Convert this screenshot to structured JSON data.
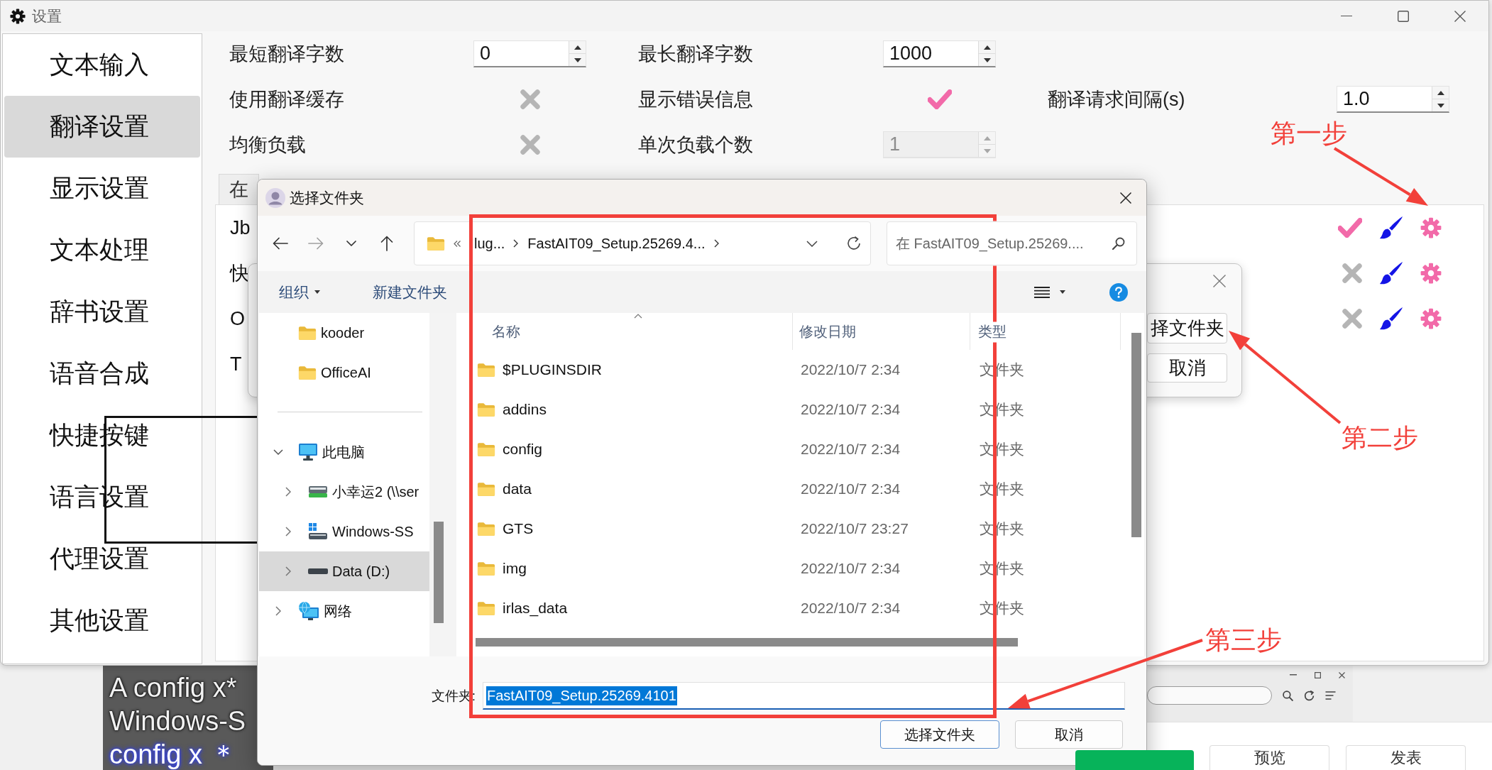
{
  "settings_window": {
    "title": "设置"
  },
  "sidebar": {
    "items": [
      {
        "label": "文本输入",
        "selected": false
      },
      {
        "label": "翻译设置",
        "selected": true
      },
      {
        "label": "显示设置",
        "selected": false
      },
      {
        "label": "文本处理",
        "selected": false
      },
      {
        "label": "辞书设置",
        "selected": false
      },
      {
        "label": "语音合成",
        "selected": false
      },
      {
        "label": "快捷按键",
        "selected": false
      },
      {
        "label": "语言设置",
        "selected": false
      },
      {
        "label": "代理设置",
        "selected": false
      },
      {
        "label": "其他设置",
        "selected": false
      }
    ]
  },
  "option_rows": [
    [
      {
        "label": "最短翻译字数",
        "kind": "spinbox",
        "value": "0",
        "disabled": false
      },
      {
        "label": "最长翻译字数",
        "kind": "spinbox",
        "value": "1000",
        "disabled": false
      }
    ],
    [
      {
        "label": "使用翻译缓存",
        "kind": "switch",
        "on": false
      },
      {
        "label": "显示错误信息",
        "kind": "switch",
        "on": true
      },
      {
        "label": "翻译请求间隔(s)",
        "kind": "spinbox",
        "value": "1.0",
        "disabled": false
      }
    ],
    [
      {
        "label": "均衡负载",
        "kind": "switch",
        "on": false
      },
      {
        "label": "单次负载个数",
        "kind": "spinbox",
        "value": "1",
        "disabled": true
      }
    ]
  ],
  "tabs": [
    {
      "label": "在",
      "selected": true
    }
  ],
  "engines": [
    {
      "name": "Jb",
      "kind": "engine",
      "on": true
    },
    {
      "name": "快",
      "kind": "engine",
      "on": false
    },
    {
      "name": "O",
      "kind": "engine",
      "on": false
    },
    {
      "name": "T",
      "kind": "plain"
    }
  ],
  "prompt_dialog": {
    "buttons": [
      {
        "label": "择文件夹"
      },
      {
        "label": "取消"
      }
    ]
  },
  "file_dialog": {
    "title": "选择文件夹",
    "nav_buttons": [
      {
        "kind": "back",
        "disabled": false
      },
      {
        "kind": "forward",
        "disabled": true
      },
      {
        "kind": "recent",
        "disabled": false
      },
      {
        "kind": "up",
        "disabled": false
      }
    ],
    "path": [
      "lug...",
      "FastAIT09_Setup.25269.4..."
    ],
    "search": {
      "placeholder": "在 FastAIT09_Setup.25269...."
    },
    "toolbar": [
      {
        "label": "组织",
        "kind": "menu"
      },
      {
        "label": "新建文件夹",
        "kind": "command"
      }
    ],
    "quick_access": [
      {
        "label": "kooder",
        "kind": "folder",
        "selected": false
      },
      {
        "label": "OfficeAI",
        "kind": "folder",
        "selected": false
      }
    ],
    "tree": [
      {
        "label": "此电脑",
        "kind": "computer",
        "expanded": true,
        "selected": false,
        "children": [
          {
            "label": "小幸运2 (\\\\ser",
            "kind": "network-drive",
            "expanded": false,
            "selected": false
          },
          {
            "label": "Windows-SS",
            "kind": "system-drive",
            "expanded": false,
            "selected": false
          },
          {
            "label": "Data (D:)",
            "kind": "drive",
            "expanded": false,
            "selected": true
          }
        ]
      },
      {
        "label": "网络",
        "kind": "network",
        "expanded": false,
        "selected": false
      }
    ],
    "columns": [
      {
        "label": "名称",
        "sorted": true
      },
      {
        "label": "修改日期",
        "sorted": false
      },
      {
        "label": "类型",
        "sorted": false
      }
    ],
    "rows": [
      {
        "name": "$PLUGINSDIR",
        "modified": "2022/10/7 2:34",
        "type": "文件夹"
      },
      {
        "name": "addins",
        "modified": "2022/10/7 2:34",
        "type": "文件夹"
      },
      {
        "name": "config",
        "modified": "2022/10/7 2:34",
        "type": "文件夹"
      },
      {
        "name": "data",
        "modified": "2022/10/7 2:34",
        "type": "文件夹"
      },
      {
        "name": "GTS",
        "modified": "2022/10/7 23:27",
        "type": "文件夹"
      },
      {
        "name": "img",
        "modified": "2022/10/7 2:34",
        "type": "文件夹"
      },
      {
        "name": "irlas_data",
        "modified": "2022/10/7 2:34",
        "type": "文件夹"
      }
    ],
    "folder_field": {
      "label": "文件夹:",
      "value": "FastAIT09_Setup.25269.4101",
      "highlighted": true
    },
    "buttons": [
      {
        "label": "选择文件夹",
        "default": true
      },
      {
        "label": "取消",
        "default": false
      }
    ]
  },
  "annotations": [
    {
      "label": "第一步"
    },
    {
      "label": "第二步"
    },
    {
      "label": "第三步"
    }
  ],
  "backdrop": {
    "caption_lines": [
      {
        "text": "A config x*",
        "highlighted": false
      },
      {
        "text": "Windows-S",
        "highlighted": false
      },
      {
        "text": "config x ＊",
        "highlighted": true
      }
    ],
    "page_buttons": [
      {
        "kind": "primary"
      },
      {
        "label": "预览",
        "kind": "outline"
      },
      {
        "label": "发表",
        "kind": "outline"
      }
    ]
  }
}
